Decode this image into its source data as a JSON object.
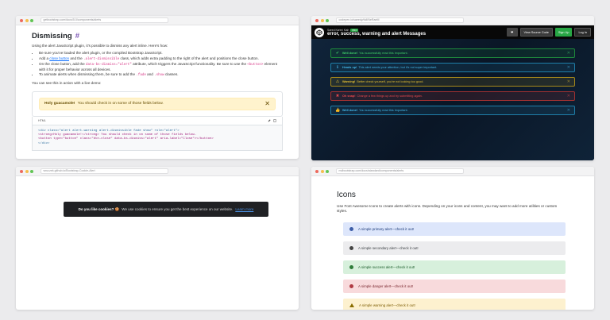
{
  "win1": {
    "url": "getbootstrap.com/docs/5.0/components/alerts",
    "title": "Dismissing",
    "hash": "#",
    "intro": "Using the alert JavaScript plugin, it's possible to dismiss any alert inline. Here's how:",
    "bullets": [
      {
        "parts": [
          "Be sure you've loaded the alert plugin, or the compiled Bootstrap JavaScript."
        ]
      },
      {
        "pre": "Add a ",
        "link": "close button",
        "mid": " and the ",
        "code": ".alert-dismissible",
        "post": " class, which adds extra padding to the right of the alert and positions the close button."
      },
      {
        "pre": "On the close button, add the ",
        "code": "data-bs-dismiss=\"alert\"",
        "post": " attribute, which triggers the JavaScript functionality. Be sure to use the ",
        "code2": "<button>",
        "post2": " element with it for proper behavior across all devices."
      },
      {
        "pre": "To animate alerts when dismissing them, be sure to add the ",
        "code": ".fade",
        "mid": " and ",
        "code2": ".show",
        "post": " classes."
      }
    ],
    "demo_text": "You can see this in action with a live demo:",
    "alert_strong": "Holy guacamole!",
    "alert_text": "You should check in on some of those fields below.",
    "close_glyph": "✕",
    "tab_label": "HTML",
    "code_lines": [
      "<div class=\"alert alert-warning alert-dismissible fade show\" role=\"alert\">",
      "  <strong>Holy guacamole!</strong> You should check in on some of those fields below.",
      "  <button type=\"button\" class=\"btn-close\" data-bs-dismiss=\"alert\" aria-label=\"Close\"></button>",
      "</div>"
    ]
  },
  "win2": {
    "url": "codepen.io/saeedy/full/NeRaeM",
    "small_title": "Saeed Karimi Kiah",
    "badge": "PRO",
    "title": "error, success, warning and alert Messages",
    "heart": "❤",
    "view_source": "View Source Code",
    "signup": "Sign Up",
    "login": "Log In",
    "alerts": [
      {
        "cls": "da-ok",
        "icon": "✔",
        "strong": "Well done!",
        "text": "You successfully read this important.",
        "close": "✕"
      },
      {
        "cls": "da-info",
        "icon": "ℹ",
        "strong": "Heads up!",
        "text": "This alert needs your attention, but it's not super important.",
        "close": "✕"
      },
      {
        "cls": "da-warn",
        "icon": "⚠",
        "strong": "Warning!",
        "text": "Better check yourself, you're not looking too good.",
        "close": "✕"
      },
      {
        "cls": "da-err",
        "icon": "✖",
        "strong": "Oh snap!",
        "text": "Change a few things up and try submitting again.",
        "close": "✕"
      },
      {
        "cls": "da-ok2",
        "icon": "👍",
        "strong": "Well done!",
        "text": "You successfully read this important.",
        "close": "✕"
      }
    ]
  },
  "win3": {
    "url": "wruczek.github.io/Bootstrap-Cookie-Alert",
    "cookie_strong": "Do you like cookies? 🍪",
    "cookie_text": "We use cookies to ensure you get the best experience on our website.",
    "cookie_link": "Learn more"
  },
  "win4": {
    "url": "mdbootstrap.com/docs/standard/components/alerts",
    "title": "Icons",
    "para": "Use Font Awesome Icons to create alerts with icons. Depending on your icons and content, you may want to add more utilities or custom styles.",
    "alerts": [
      {
        "cls": "ba-primary",
        "text": "A simple primary alert—check it out!"
      },
      {
        "cls": "ba-secondary",
        "text": "A simple secondary alert—check it out!"
      },
      {
        "cls": "ba-success",
        "text": "A simple success alert—check it out!"
      },
      {
        "cls": "ba-danger",
        "text": "A simple danger alert—check it out!"
      },
      {
        "cls": "ba-warning",
        "text": "A simple warning alert—check it out!"
      }
    ]
  }
}
